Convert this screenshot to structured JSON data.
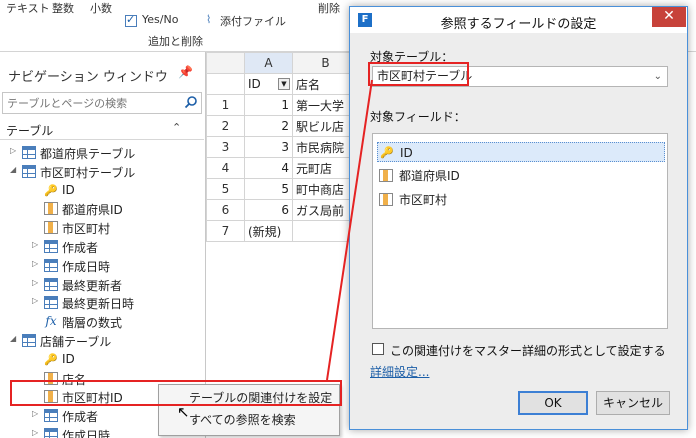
{
  "ribbon": {
    "items": [
      "テキスト",
      "整数",
      "小数"
    ],
    "yesno_label": "Yes/No",
    "attach_label": "添付ファイル",
    "group_label": "追加と削除",
    "delete_label": "削除"
  },
  "nav": {
    "title": "ナビゲーション ウィンドウ",
    "search_placeholder": "テーブルとページの検索",
    "section_label": "テーブル",
    "items": [
      {
        "label": "都道府県テーブル",
        "icon": "table",
        "level": 0,
        "expander": "collapsed"
      },
      {
        "label": "市区町村テーブル",
        "icon": "table",
        "level": 0,
        "expander": "expanded"
      },
      {
        "label": "ID",
        "icon": "key",
        "level": 1,
        "expander": "none"
      },
      {
        "label": "都道府県ID",
        "icon": "field",
        "level": 1,
        "expander": "none"
      },
      {
        "label": "市区町村",
        "icon": "field",
        "level": 1,
        "expander": "none"
      },
      {
        "label": "作成者",
        "icon": "table",
        "level": 1,
        "expander": "collapsed"
      },
      {
        "label": "作成日時",
        "icon": "table",
        "level": 1,
        "expander": "collapsed"
      },
      {
        "label": "最終更新者",
        "icon": "table",
        "level": 1,
        "expander": "collapsed"
      },
      {
        "label": "最終更新日時",
        "icon": "table",
        "level": 1,
        "expander": "collapsed"
      },
      {
        "label": "階層の数式",
        "icon": "fx",
        "level": 1,
        "expander": "none"
      },
      {
        "label": "店舗テーブル",
        "icon": "table",
        "level": 0,
        "expander": "expanded"
      },
      {
        "label": "ID",
        "icon": "key",
        "level": 1,
        "expander": "none"
      },
      {
        "label": "店名",
        "icon": "field",
        "level": 1,
        "expander": "none"
      },
      {
        "label": "市区町村ID",
        "icon": "field",
        "level": 1,
        "expander": "none"
      },
      {
        "label": "作成者",
        "icon": "table",
        "level": 1,
        "expander": "collapsed"
      },
      {
        "label": "作成日時",
        "icon": "table",
        "level": 1,
        "expander": "collapsed"
      }
    ]
  },
  "grid": {
    "columns": [
      "A",
      "B"
    ],
    "headers": [
      "ID",
      "店名"
    ],
    "rows": [
      {
        "num": "1",
        "id": "1",
        "name": "第一大学"
      },
      {
        "num": "2",
        "id": "2",
        "name": "駅ビル店"
      },
      {
        "num": "3",
        "id": "3",
        "name": "市民病院"
      },
      {
        "num": "4",
        "id": "4",
        "name": "元町店"
      },
      {
        "num": "5",
        "id": "5",
        "name": "町中商店"
      },
      {
        "num": "6",
        "id": "6",
        "name": "ガス局前"
      },
      {
        "num": "7",
        "id": "(新規)",
        "name": ""
      }
    ]
  },
  "context_menu": {
    "items": [
      "テーブルの関連付けを設定",
      "すべての参照を検索"
    ]
  },
  "dialog": {
    "title": "参照するフィールドの設定",
    "table_label": "対象テーブル：",
    "table_value": "市区町村テーブル",
    "field_label": "対象フィールド：",
    "fields": [
      {
        "label": "ID",
        "icon": "key"
      },
      {
        "label": "都道府県ID",
        "icon": "field"
      },
      {
        "label": "市区町村",
        "icon": "field"
      }
    ],
    "checkbox_label": "この関連付けをマスター詳細の形式として設定する",
    "link_label": "詳細設定...",
    "ok_label": "OK",
    "cancel_label": "キャンセル"
  },
  "colors": {
    "accent": "#1d6fc7",
    "highlight_red": "#e52323",
    "close_red": "#c7423a"
  }
}
